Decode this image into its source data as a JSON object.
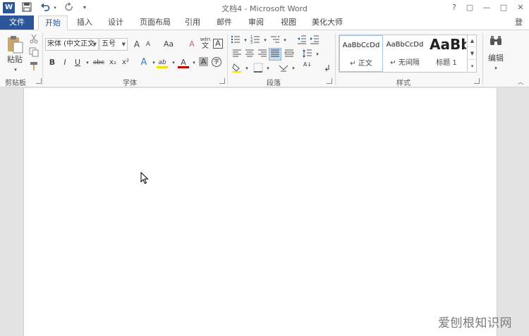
{
  "titlebar": {
    "logo": "W",
    "title": "文档4 - Microsoft Word",
    "qa_save_icon": "save-icon",
    "qa_undo_icon": "undo-icon",
    "qa_redo_icon": "redo-icon",
    "qa_customize_icon": "customize-icon",
    "help": "?",
    "ribbon_display": "▢",
    "minimize": "—",
    "restore": "□",
    "close": "✕"
  },
  "tabs": {
    "file": "文件",
    "items": [
      "开始",
      "插入",
      "设计",
      "页面布局",
      "引用",
      "邮件",
      "审阅",
      "视图",
      "美化大师"
    ],
    "login": "登录"
  },
  "ribbon": {
    "clipboard": {
      "paste_label": "粘贴",
      "group_label": "剪贴板"
    },
    "font": {
      "font_name": "宋体 (中文正文",
      "font_size": "五号",
      "grow": "A",
      "shrink": "A",
      "change_case": "Aa",
      "clear_format": "A",
      "phonetic": "wén",
      "phonetic_char": "文",
      "border_char": "A",
      "bold": "B",
      "italic": "I",
      "underline": "U",
      "strike": "abc",
      "subscript": "x₂",
      "superscript": "x²",
      "text_effect": "A",
      "highlight": "ab",
      "font_color": "A",
      "char_shading": "A",
      "enclose": "字",
      "group_label": "字体"
    },
    "paragraph": {
      "group_label": "段落",
      "sort": "A↓"
    },
    "styles": {
      "items": [
        {
          "sample": "AaBbCcDd",
          "name": "↵ 正文"
        },
        {
          "sample": "AaBbCcDd",
          "name": "↵ 无间隔"
        },
        {
          "sample": "AaBb",
          "name": "标题 1"
        }
      ],
      "group_label": "样式"
    },
    "editing": {
      "label": "编辑"
    }
  },
  "watermark": "爱刨根知识网"
}
